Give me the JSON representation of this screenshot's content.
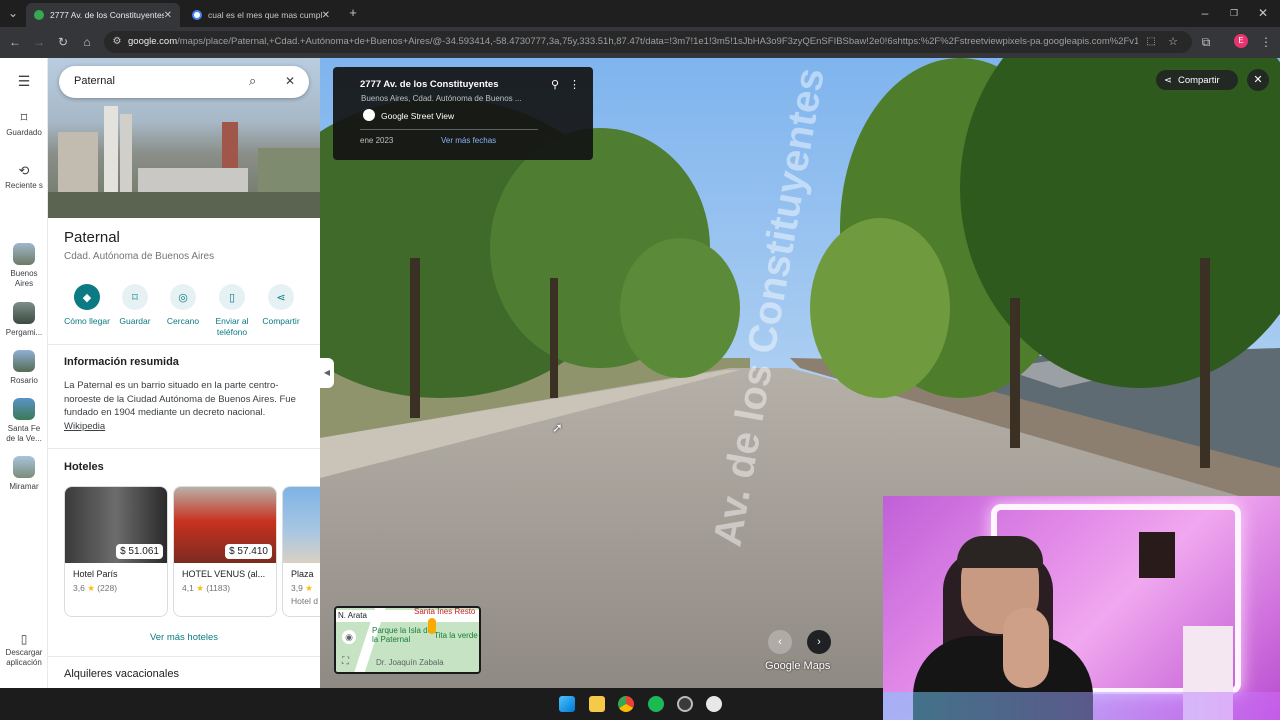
{
  "browser": {
    "tabs": [
      {
        "title": "2777 Av. de los Constituyentes",
        "active": true
      },
      {
        "title": "cual es el mes que mas cumple",
        "active": false
      }
    ],
    "new_tab": "+",
    "url_host": "google.com",
    "url_rest": "/maps/place/Paternal,+Cdad.+Autónoma+de+Buenos+Aires/@-34.593414,-58.4730777,3a,75y,333.51h,87.47t/data=!3m7!1e1!3m5!1sJbHA3o9F3zyQEnSFIBSbaw!2e0!6shttps:%2F%2Fstreetviewpixels-pa.googleapis.com%2Fv1%2Fth...",
    "profile_initial": "E"
  },
  "rail": {
    "items": [
      {
        "label": "Guardado",
        "icon": "bookmark-icon"
      },
      {
        "label": "Reciente s",
        "icon": "history-icon"
      }
    ],
    "recents": [
      {
        "label": "Buenos Aires"
      },
      {
        "label": "Pergami..."
      },
      {
        "label": "Rosario"
      },
      {
        "label": "Santa Fe de la Ve..."
      },
      {
        "label": "Miramar"
      }
    ],
    "download": "Descargar aplicación"
  },
  "panel": {
    "search_value": "Paternal",
    "title": "Paternal",
    "subtitle": "Cdad. Autónoma de Buenos Aires",
    "actions": [
      {
        "label": "Cómo llegar",
        "icon": "directions-icon"
      },
      {
        "label": "Guardar",
        "icon": "bookmark-icon"
      },
      {
        "label": "Cercano",
        "icon": "nearby-icon"
      },
      {
        "label": "Enviar al teléfono",
        "icon": "phone-icon"
      },
      {
        "label": "Compartir",
        "icon": "share-icon"
      }
    ],
    "summary_heading": "Información resumida",
    "summary_text": "La Paternal es un barrio situado en la parte centro-noroeste de la Ciudad Autónoma de Buenos Aires. Fue fundado en 1904 mediante un decreto nacional.",
    "summary_link": "Wikipedia",
    "hotels_heading": "Hoteles",
    "hotels": [
      {
        "name": "Hotel París",
        "price": "$ 51.061",
        "rating": "3,6",
        "reviews": "(228)"
      },
      {
        "name": "HOTEL VENUS (al...",
        "price": "$ 57.410",
        "rating": "4,1",
        "reviews": "(1183)"
      },
      {
        "name": "Plaza",
        "price": "",
        "rating": "3,9",
        "reviews": "Hotel d"
      }
    ],
    "more_hotels": "Ver más hoteles",
    "rentals_heading": "Alquileres vacacionales"
  },
  "streetview": {
    "address": "2777 Av. de los Constituyentes",
    "subtitle": "Buenos Aires, Cdad. Autónoma de Buenos ...",
    "brand": "Google Street View",
    "date": "ene 2023",
    "more_dates": "Ver más fechas",
    "share": "Compartir",
    "road_label": "Av. de los Constituyentes",
    "watermark": "Google Maps",
    "minimap": {
      "north": "N. Arata",
      "park": "Parque la Isla de la Paternal",
      "resto": "Santa Ines Resto",
      "place": "Tita la verde",
      "street": "Dr. Joaquín Zabala"
    }
  }
}
